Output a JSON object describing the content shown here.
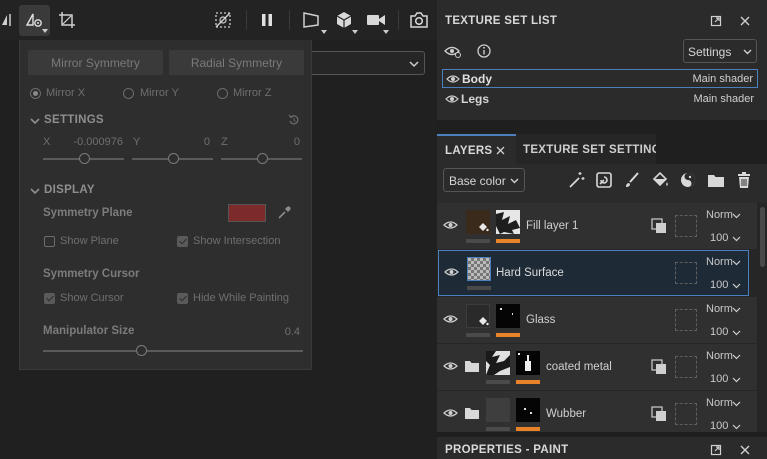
{
  "toolbar": {
    "icons": [
      "symmetry-icon",
      "symmetry-settings-icon",
      "transform-icon",
      "hide-grid-icon",
      "pause-icon",
      "camera-frame-icon",
      "3d-cube-icon",
      "video-camera-icon",
      "screenshot-icon"
    ]
  },
  "viewport": {
    "select_value": ""
  },
  "symmetry_popup": {
    "mirror_button": "Mirror Symmetry",
    "radial_button": "Radial Symmetry",
    "axes": [
      {
        "label": "Mirror X",
        "selected": true
      },
      {
        "label": "Mirror Y",
        "selected": false
      },
      {
        "label": "Mirror Z",
        "selected": false
      }
    ],
    "settings": {
      "title": "SETTINGS",
      "x_label": "X",
      "x_value": "-0.000976",
      "y_label": "Y",
      "y_value": "0",
      "z_label": "Z",
      "z_value": "0"
    },
    "display": {
      "title": "DISPLAY",
      "symmetry_plane_label": "Symmetry Plane",
      "plane_color": "#7c2a2a",
      "show_plane": {
        "label": "Show Plane",
        "checked": false
      },
      "show_intersection": {
        "label": "Show Intersection",
        "checked": true
      },
      "symmetry_cursor_label": "Symmetry Cursor",
      "show_cursor": {
        "label": "Show Cursor",
        "checked": true
      },
      "hide_while_painting": {
        "label": "Hide While Painting",
        "checked": true
      },
      "manipulator_label": "Manipulator Size",
      "manipulator_value": "0.4"
    }
  },
  "texture_set_list": {
    "title": "TEXTURE SET LIST",
    "settings_label": "Settings",
    "rows": [
      {
        "name": "Body",
        "shader": "Main shader",
        "selected": true
      },
      {
        "name": "Legs",
        "shader": "Main shader",
        "selected": false
      }
    ]
  },
  "layers_panel": {
    "tab_layers": "LAYERS",
    "tab_texture_set_settings": "TEXTURE SET SETTINGS",
    "channel": "Base color",
    "layers": [
      {
        "name": "Fill layer 1",
        "blend": "Norm",
        "opacity": "100",
        "type": "fill"
      },
      {
        "name": "Hard Surface",
        "blend": "Norm",
        "opacity": "100",
        "type": "paint"
      },
      {
        "name": "Glass",
        "blend": "Norm",
        "opacity": "100",
        "type": "fill"
      },
      {
        "name": "coated metal",
        "blend": "Norm",
        "opacity": "100",
        "type": "folder"
      },
      {
        "name": "Wubber",
        "blend": "Norm",
        "opacity": "100",
        "type": "folder"
      }
    ]
  },
  "properties": {
    "title": "PROPERTIES - PAINT"
  },
  "colors": {
    "accent_blue": "#4b7fbd",
    "accent_orange": "#e8832a"
  }
}
